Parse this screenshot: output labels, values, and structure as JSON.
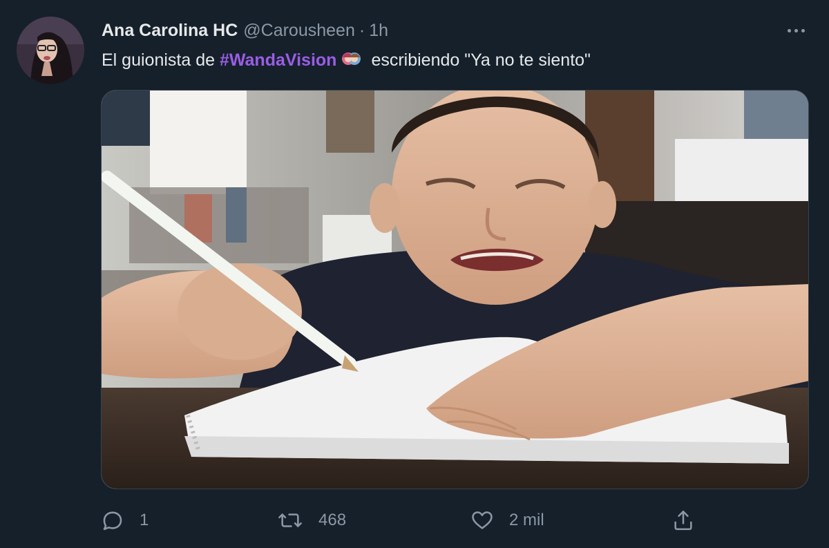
{
  "tweet": {
    "display_name": "Ana Carolina HC",
    "handle": "@Carousheen",
    "separator": "·",
    "time": "1h",
    "text_before": "El guionista de ",
    "hashtag": "#WandaVision",
    "text_after": "escribiendo \"Ya no te siento\""
  },
  "media": {
    "description_icon": "photo"
  },
  "actions": {
    "reply_count": "1",
    "retweet_count": "468",
    "like_count": "2 mil"
  },
  "icons": {
    "more": "more-dots-icon",
    "reply": "reply-icon",
    "retweet": "retweet-icon",
    "like": "heart-icon",
    "share": "share-icon",
    "hashtag_emoji": "wandavision-emoji"
  },
  "colors": {
    "background": "#15202b",
    "text": "#e7e9ea",
    "secondary": "#8b98a5",
    "hashtag": "#9b5de5"
  }
}
